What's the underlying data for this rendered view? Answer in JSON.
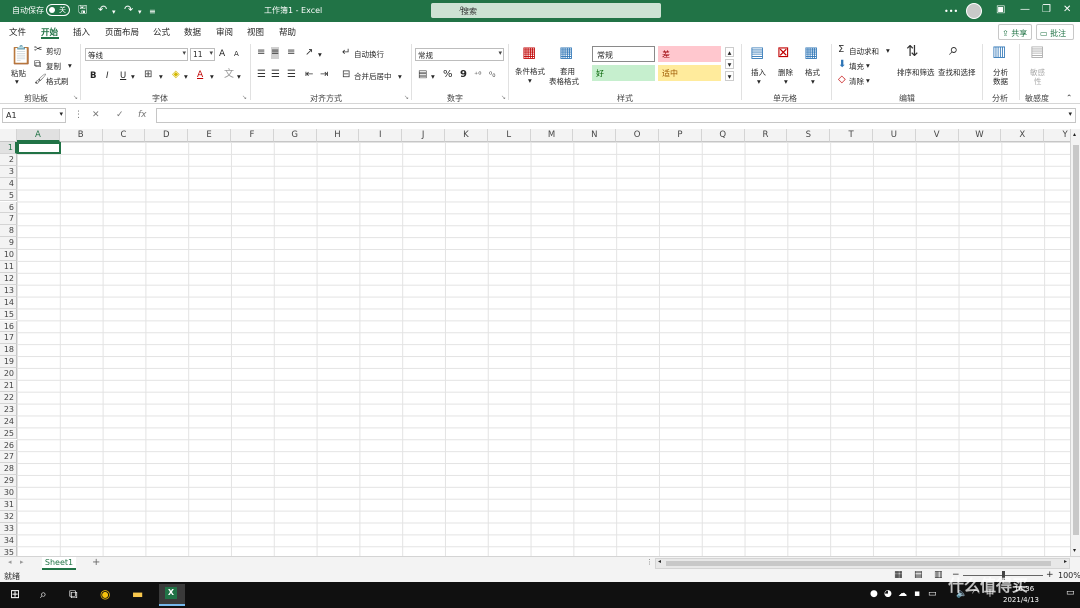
{
  "title_bar": {
    "autosave_label": "自动保存",
    "autosave_state": "关",
    "doc_title": "工作簿1 - Excel",
    "search_placeholder": "搜索",
    "icons": [
      "save-icon",
      "undo-icon",
      "redo-icon",
      "customize-icon"
    ]
  },
  "menu": {
    "items": [
      "文件",
      "开始",
      "插入",
      "页面布局",
      "公式",
      "数据",
      "审阅",
      "视图",
      "帮助"
    ],
    "active": "开始",
    "share": "共享",
    "comment": "批注"
  },
  "ribbon": {
    "clipboard": {
      "label": "剪贴板",
      "paste": "粘贴",
      "cut": "剪切",
      "copy": "复制",
      "format_painter": "格式刷"
    },
    "font": {
      "label": "字体",
      "name": "等线",
      "size": "11",
      "bold": "B",
      "italic": "I",
      "underline": "U",
      "grow": "A",
      "shrink": "A",
      "font_color": "A"
    },
    "alignment": {
      "label": "对齐方式",
      "wrap": "自动换行",
      "merge": "合并后居中"
    },
    "number": {
      "label": "数字",
      "format": "常规",
      "percent": "%",
      "comma": "9"
    },
    "styles": {
      "label": "样式",
      "conditional": "条件格式",
      "table_line1": "套用",
      "table_line2": "表格格式",
      "normal": "常规",
      "bad": "差",
      "good": "好",
      "neutral": "适中"
    },
    "cells": {
      "label": "单元格",
      "insert": "插入",
      "delete": "删除",
      "format": "格式"
    },
    "editing": {
      "label": "编辑",
      "autosum": "自动求和",
      "fill": "填充",
      "clear": "清除",
      "sort": "排序和筛选",
      "find": "查找和选择"
    },
    "analysis": {
      "label": "分析",
      "analyze_line1": "分析",
      "analyze_line2": "数据"
    },
    "sensitivity": {
      "label": "敏感度",
      "btn_line1": "敏感",
      "btn_line2": "性"
    }
  },
  "formula_bar": {
    "namebox": "A1",
    "cancel": "✕",
    "enter": "✓",
    "fx": "fx",
    "value": ""
  },
  "columns": [
    "A",
    "B",
    "C",
    "D",
    "E",
    "F",
    "G",
    "H",
    "I",
    "J",
    "K",
    "L",
    "M",
    "N",
    "O",
    "P",
    "Q",
    "R",
    "S",
    "T",
    "U",
    "V",
    "W",
    "X",
    "Y"
  ],
  "rows": [
    "1",
    "2",
    "3",
    "4",
    "5",
    "6",
    "7",
    "8",
    "9",
    "10",
    "11",
    "12",
    "13",
    "14",
    "15",
    "16",
    "17",
    "18",
    "19",
    "20",
    "21",
    "22",
    "23",
    "24",
    "25",
    "26",
    "27",
    "28",
    "29",
    "30",
    "31",
    "32",
    "33",
    "34",
    "35"
  ],
  "sheets": {
    "tabs": [
      "Sheet1"
    ],
    "add": "+"
  },
  "status": {
    "text": "就绪",
    "zoom": "100%"
  },
  "taskbar": {
    "time": "16:36",
    "date": "2021/4/13",
    "ime": "中",
    "watermark": "什么值得买"
  },
  "colors": {
    "accent": "#217346",
    "bad_bg": "#ffc7ce",
    "bad_fg": "#9c0006",
    "good_bg": "#c6efce",
    "good_fg": "#006100",
    "neutral_bg": "#ffeb9c",
    "neutral_fg": "#9c5700"
  }
}
